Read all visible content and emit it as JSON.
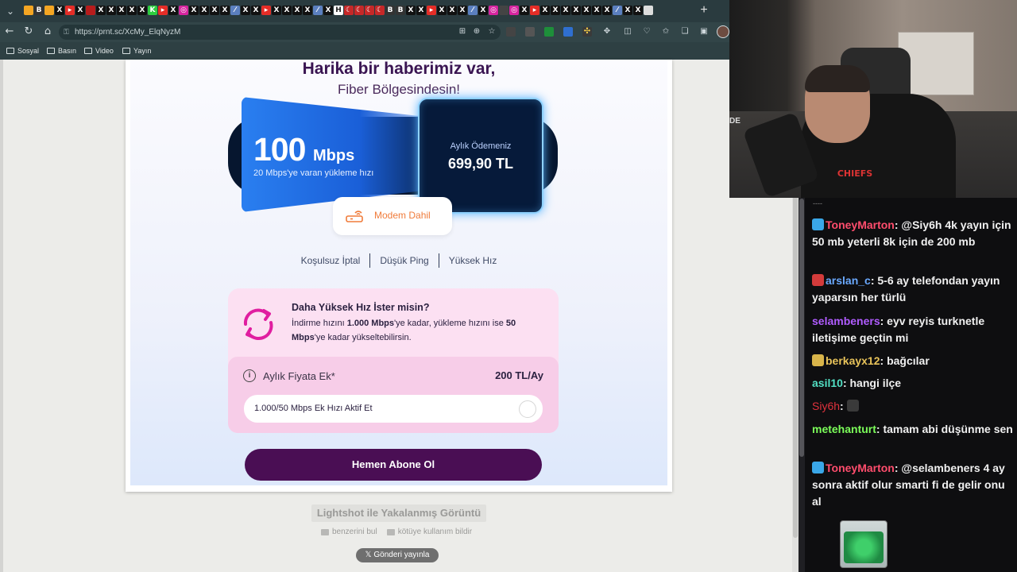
{
  "browser": {
    "tabs": [
      "a",
      "b",
      "c",
      "x",
      "yt",
      "x",
      "pin",
      "x",
      "x",
      "x",
      "x",
      "x",
      "k",
      "yt",
      "x",
      "ig",
      "x",
      "x",
      "x",
      "x",
      "e",
      "x",
      "x",
      "yt",
      "x",
      "x",
      "x",
      "x",
      "e",
      "x",
      "h",
      "tr",
      "tr",
      "tr",
      "tr",
      "b",
      "b",
      "x",
      "x",
      "yt",
      "x",
      "x",
      "x",
      "e",
      "x",
      "ig",
      "o",
      "ig",
      "x",
      "yt",
      "x",
      "x",
      "x",
      "x",
      "x",
      "x",
      "x",
      "e",
      "x",
      "x",
      "ch"
    ],
    "tab_new_label": "+",
    "url": "https://prnt.sc/XcMy_ElqNyzM",
    "bookmarks": [
      "Sosyal",
      "Basın",
      "Video",
      "Yayın"
    ]
  },
  "ad": {
    "headline": "Harika bir haberimiz var,",
    "subheadline": "Fiber Bölgesindesin!",
    "speed": "100",
    "speed_unit": "Mbps",
    "upload_text": "20 Mbps'ye varan yükleme hızı",
    "payment_label": "Aylık Ödemeniz",
    "payment_value": "699,90 TL",
    "modem_label": "Modem Dahil",
    "features": [
      "Koşulsuz İptal",
      "Düşük Ping",
      "Yüksek Hız"
    ],
    "upgrade_title": "Daha Yüksek Hız İster misin?",
    "upgrade_desc_1": "İndirme hızını ",
    "upgrade_desc_bold_1": "1.000 Mbps",
    "upgrade_desc_2": "'ye kadar, yükleme hızını ise ",
    "upgrade_desc_bold_2": "50 Mbps",
    "upgrade_desc_3": "'ye kadar yükseltebilirsin.",
    "monthly_label": "Aylık Fiyata Ek*",
    "monthly_price": "200 TL/Ay",
    "toggle_label": "1.000/50 Mbps Ek Hızı Aktif Et",
    "toggle_on": false,
    "cta_label": "Hemen Abone Ol"
  },
  "lightshot": {
    "title": "Lightshot ile Yakalanmış Görüntü",
    "similar": "benzerini bul",
    "report": "kötüye kullanım bildir",
    "tweet": "Gönderi yayınla"
  },
  "camera": {
    "shirt_text": "CHIEFS",
    "sign_text": "DE"
  },
  "chat": {
    "top_fragment": "----",
    "messages": [
      {
        "user": "ToneyMarton",
        "color": "#ff4d6d",
        "badge": "#3aa7e8",
        "text": "@Siy6h 4k yayın için 50 mb yeterli 8k için de 200 mb"
      },
      {
        "user": "arslan_c",
        "color": "#6aa9ff",
        "badge": "#d33b3b",
        "text": "5-6 ay telefondan yayın yaparsın her türlü"
      },
      {
        "user": "selambeners",
        "color": "#b05cff",
        "badge": "",
        "text": "eyv reyis turknetle iletişime geçtin mi"
      },
      {
        "user": "berkayx12",
        "color": "#e8c35a",
        "badge": "#d8b44a",
        "text": "bağcılar"
      },
      {
        "user": "asil10",
        "color": "#52e0c4",
        "badge": "",
        "text": "hangi ilçe"
      },
      {
        "user": "Siy6h",
        "color": "#e0323c",
        "badge": "",
        "text": ""
      },
      {
        "user": "metehanturt",
        "color": "#7cff5a",
        "badge": "",
        "text": "tamam abi düşünme sen"
      },
      {
        "user": "ToneyMarton",
        "color": "#ff4d6d",
        "badge": "#3aa7e8",
        "text": "@selambeners 4 ay sonra aktif olur smarti fi de gelir onu al"
      }
    ]
  }
}
